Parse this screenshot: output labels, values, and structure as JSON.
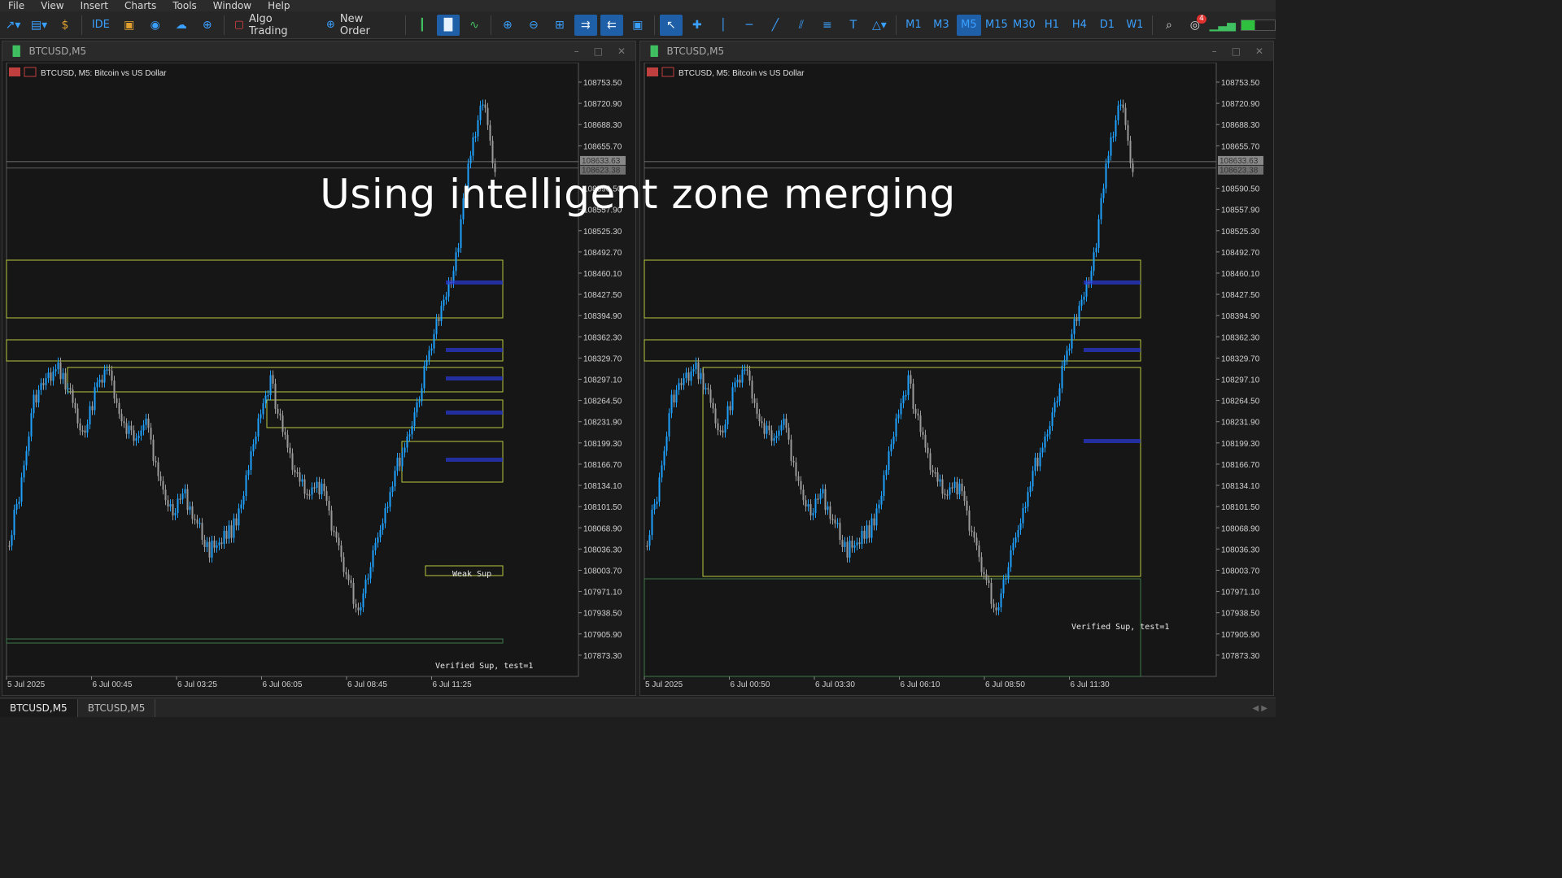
{
  "menu": [
    "File",
    "View",
    "Insert",
    "Charts",
    "Tools",
    "Window",
    "Help"
  ],
  "toolbar": {
    "algo_trading": "Algo Trading",
    "new_order": "New Order",
    "ide": "IDE",
    "timeframes": [
      "M1",
      "M3",
      "M5",
      "M15",
      "M30",
      "H1",
      "H4",
      "D1",
      "W1"
    ],
    "active_timeframe": "M5",
    "notification_count": "4"
  },
  "overlay_text": "Using intelligent zone merging",
  "charts": [
    {
      "window_title": "BTCUSD,M5",
      "header": "BTCUSD, M5:  Bitcoin vs US Dollar",
      "price_labels": [
        "108753.50",
        "108720.90",
        "108688.30",
        "108655.70",
        "108590.50",
        "108557.90",
        "108525.30",
        "108492.70",
        "108460.10",
        "108427.50",
        "108394.90",
        "108362.30",
        "108329.70",
        "108297.10",
        "108264.50",
        "108231.90",
        "108199.30",
        "108166.70",
        "108134.10",
        "108101.50",
        "108068.90",
        "108036.30",
        "108003.70",
        "107971.10",
        "107938.50",
        "107905.90",
        "107873.30"
      ],
      "current_price_labels": [
        "108633.63",
        "108623.38"
      ],
      "time_labels": [
        "5 Jul 2025",
        "6 Jul 00:45",
        "6 Jul 03:25",
        "6 Jul 06:05",
        "6 Jul 08:45",
        "6 Jul 11:25"
      ],
      "zone_labels": [
        "Weak Sup",
        "Verified Sup, test=1"
      ]
    },
    {
      "window_title": "BTCUSD,M5",
      "header": "BTCUSD, M5:  Bitcoin vs US Dollar",
      "price_labels": [
        "108753.50",
        "108720.90",
        "108688.30",
        "108655.70",
        "108590.50",
        "108557.90",
        "108525.30",
        "108492.70",
        "108460.10",
        "108427.50",
        "108394.90",
        "108362.30",
        "108329.70",
        "108297.10",
        "108264.50",
        "108231.90",
        "108199.30",
        "108166.70",
        "108134.10",
        "108101.50",
        "108068.90",
        "108036.30",
        "108003.70",
        "107971.10",
        "107938.50",
        "107905.90",
        "107873.30"
      ],
      "current_price_labels": [
        "108633.63",
        "108623.38"
      ],
      "time_labels": [
        "5 Jul 2025",
        "6 Jul 00:50",
        "6 Jul 03:30",
        "6 Jul 06:10",
        "6 Jul 08:50",
        "6 Jul 11:30"
      ],
      "zone_labels": [
        "Verified Sup, test=1"
      ]
    }
  ],
  "tabs": [
    "BTCUSD,M5",
    "BTCUSD,M5"
  ],
  "colors": {
    "bull": "#1ea0ff",
    "bear": "#9a9a9a",
    "zone": "#b8c840",
    "zone_support": "#3e7a4a",
    "zone_label_blue": "#2a3bd8"
  }
}
